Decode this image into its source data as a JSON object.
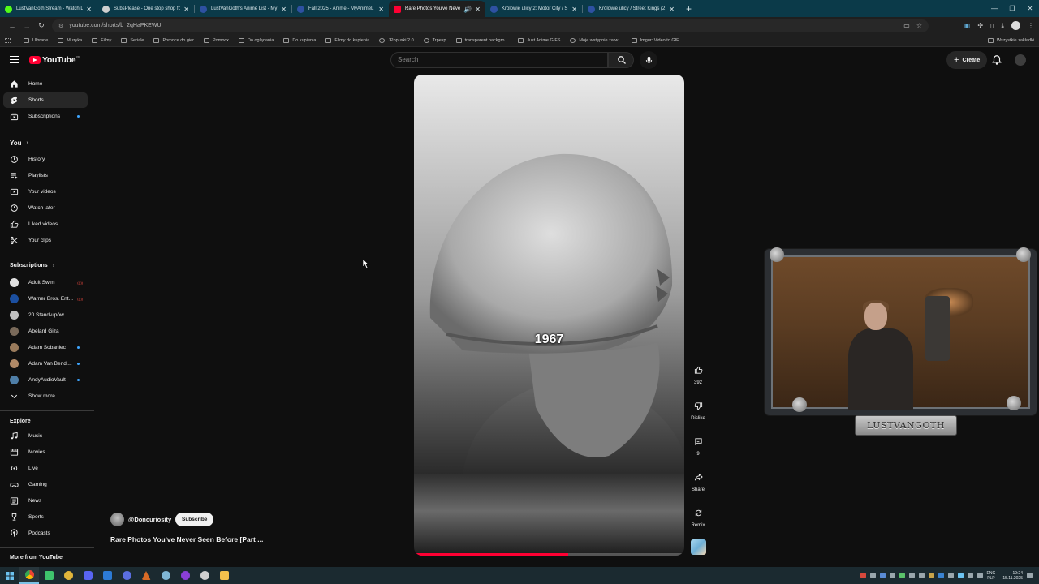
{
  "browser": {
    "tabs": [
      {
        "title": "LustVanGoth Stream - Watch L",
        "color": "#53fc18"
      },
      {
        "title": "SubsPlease - One stop shop fo",
        "color": "#cfcfcf"
      },
      {
        "title": "LustVanGoth's Anime List - My",
        "color": "#2e51a2"
      },
      {
        "title": "Fall 2025 - Anime - MyAnimeL",
        "color": "#2e51a2"
      },
      {
        "title": "Rare Photos You've Never S",
        "color": "#ff0033"
      },
      {
        "title": "Królowie ulicy 2: Motor City / S",
        "color": "#2e51a2"
      },
      {
        "title": "Królowie ulicy / Street Kings (2",
        "color": "#2e51a2"
      }
    ],
    "url": "youtube.com/shorts/b_2qHaPKEWU",
    "bookmarks": [
      "Ulbrane",
      "Muzyka",
      "Filmy",
      "Seriale",
      "Pomoce do gier",
      "Pomocx",
      "Do oglądania",
      "Do kupienia",
      "Filmy do kupienia",
      "JPopuski 2.0",
      "Trpexp",
      "transparent backgro...",
      "Just Anime GIFS",
      "Moje wstępnie zatw...",
      "Imgur: Video to GIF"
    ],
    "all_bookmarks": "Wszystkie zakładki"
  },
  "masthead": {
    "logo": "YouTube",
    "country": "PL",
    "search_placeholder": "Search",
    "create_label": "Create"
  },
  "guide": {
    "main": [
      {
        "label": "Home",
        "icon": "home-icon"
      },
      {
        "label": "Shorts",
        "icon": "shorts-icon"
      },
      {
        "label": "Subscriptions",
        "icon": "subscriptions-icon"
      }
    ],
    "you_header": "You",
    "you": [
      {
        "label": "History",
        "icon": "history-icon"
      },
      {
        "label": "Playlists",
        "icon": "playlists-icon"
      },
      {
        "label": "Your videos",
        "icon": "your-videos-icon"
      },
      {
        "label": "Watch later",
        "icon": "watch-later-icon"
      },
      {
        "label": "Liked videos",
        "icon": "liked-icon"
      },
      {
        "label": "Your clips",
        "icon": "clips-icon"
      }
    ],
    "subs_header": "Subscriptions",
    "subs": [
      {
        "label": "Adult Swim",
        "color": "#e0e0e0",
        "live": true
      },
      {
        "label": "Warner Bros. Ent...",
        "color": "#1b4fa0",
        "live": true
      },
      {
        "label": "20 Stand-upów",
        "color": "#c0c0c0",
        "live": false
      },
      {
        "label": "Abelard Giza",
        "color": "#7a6a5a",
        "live": false
      },
      {
        "label": "Adam Sobaniec",
        "color": "#9a7b5c",
        "live": false,
        "dot": true
      },
      {
        "label": "Adam Van Bendl...",
        "color": "#b08a68",
        "live": false,
        "dot": true
      },
      {
        "label": "AndyAudioVault",
        "color": "#4f7fa8",
        "live": false,
        "dot": true
      }
    ],
    "show_more": "Show more",
    "explore_header": "Explore",
    "explore": [
      {
        "label": "Music",
        "icon": "music-icon"
      },
      {
        "label": "Movies",
        "icon": "movies-icon"
      },
      {
        "label": "Live",
        "icon": "live-icon"
      },
      {
        "label": "Gaming",
        "icon": "gaming-icon"
      },
      {
        "label": "News",
        "icon": "news-icon"
      },
      {
        "label": "Sports",
        "icon": "sports-icon"
      },
      {
        "label": "Podcasts",
        "icon": "podcasts-icon"
      }
    ],
    "more_header": "More from YouTube"
  },
  "short": {
    "overlay_text": "1967",
    "progress": 0.57,
    "channel": "@Doncuriosity",
    "subscribe_label": "Subscribe",
    "title": "Rare Photos You've Never Seen Before [Part ...",
    "actions": {
      "like_count": "392",
      "dislike_label": "Dislike",
      "comments_count": "9",
      "share_label": "Share",
      "remix_label": "Remix"
    }
  },
  "stream_overlay": {
    "nameplate": "LUSTVANGOTH"
  },
  "taskbar": {
    "lang_line1": "ENG",
    "lang_line2": "PLP",
    "time": "19:24",
    "date": "15.11.2025"
  }
}
